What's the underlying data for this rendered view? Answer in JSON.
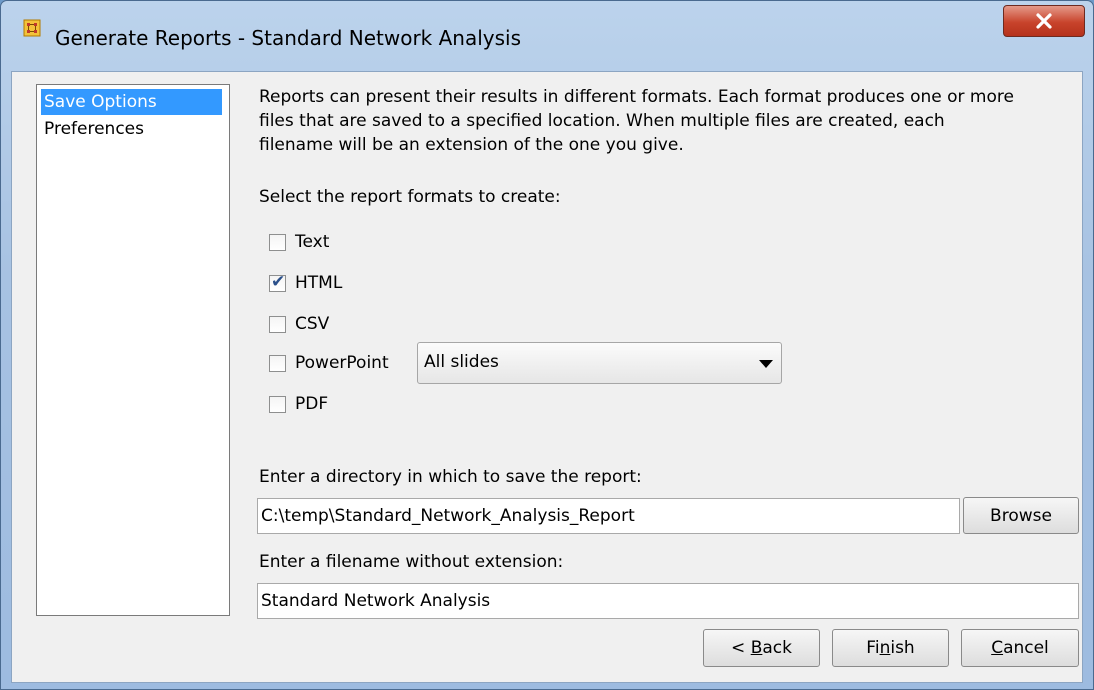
{
  "window": {
    "title": "Generate Reports - Standard Network Analysis",
    "app_icon": "network-grid-icon",
    "close_icon": "close-icon"
  },
  "nav": {
    "items": [
      {
        "label": "Save Options",
        "selected": true
      },
      {
        "label": "Preferences",
        "selected": false
      }
    ]
  },
  "main": {
    "description_lines": [
      "Reports can present their results in different formats. Each format produces one or more",
      "files that are saved to a specified location. When multiple files are created, each",
      "filename will be an extension of the one you give."
    ],
    "formats_prompt": "Select the report formats to create:",
    "formats": [
      {
        "label": "Text",
        "checked": false
      },
      {
        "label": "HTML",
        "checked": true
      },
      {
        "label": "CSV",
        "checked": false
      },
      {
        "label": "PowerPoint",
        "checked": false
      },
      {
        "label": "PDF",
        "checked": false
      }
    ],
    "powerpoint_option": "All slides",
    "directory_prompt": "Enter a directory in which to save the report:",
    "directory_value": "C:\\temp\\Standard_Network_Analysis_Report",
    "browse_label": "Browse",
    "filename_prompt": "Enter a filename without extension:",
    "filename_value": "Standard Network Analysis"
  },
  "footer": {
    "back_prefix": "< ",
    "back_accel": "B",
    "back_rest": "ack",
    "finish_prefix": "Fi",
    "finish_accel": "n",
    "finish_rest": "ish",
    "cancel_accel": "C",
    "cancel_rest": "ancel"
  }
}
